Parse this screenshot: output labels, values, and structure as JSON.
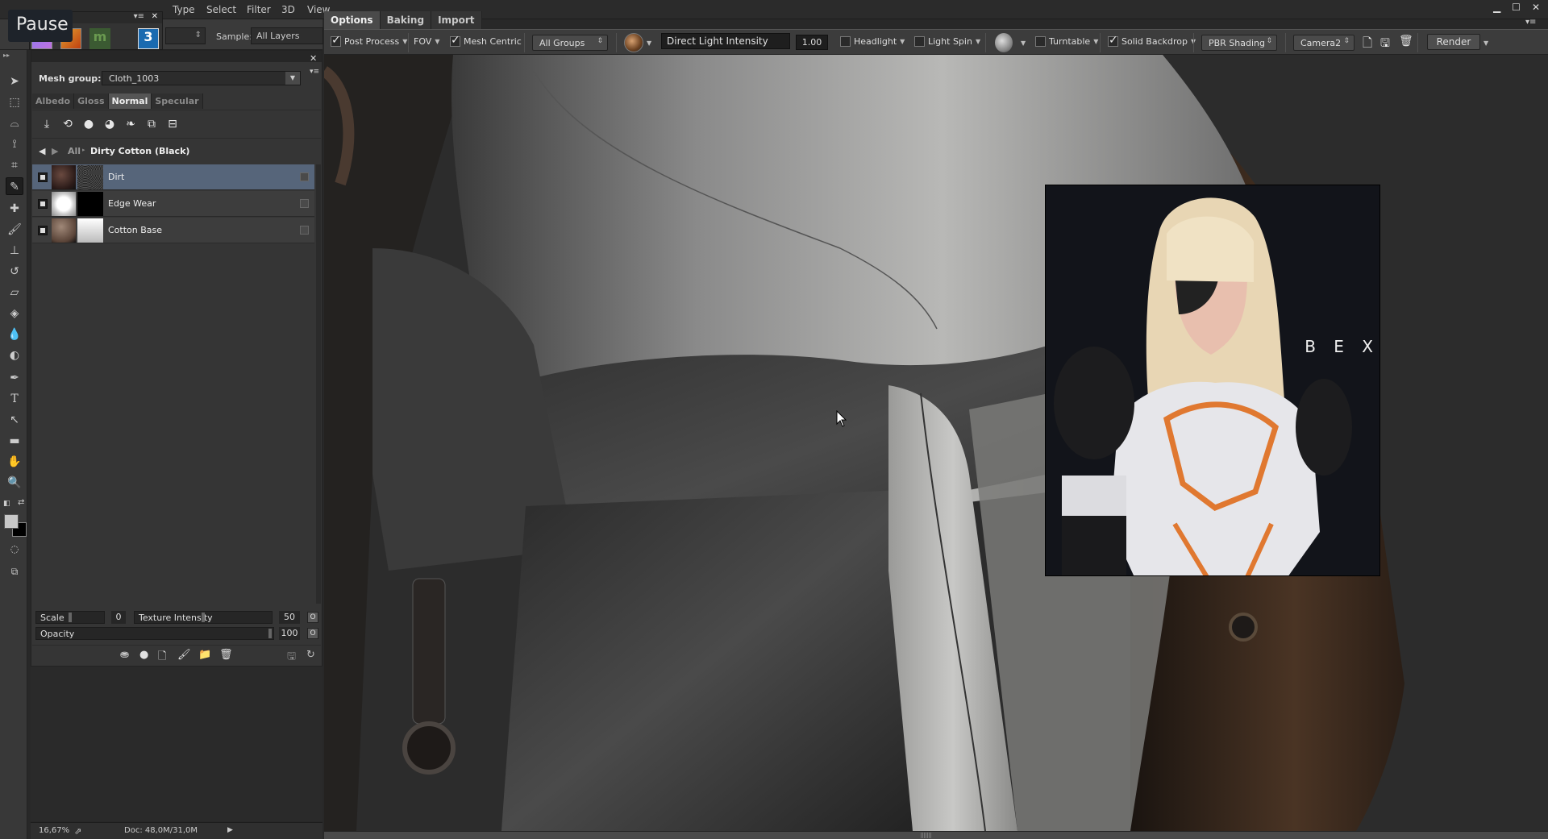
{
  "menubar": {
    "items": [
      "Type",
      "Select",
      "Filter",
      "3D",
      "View"
    ],
    "window_controls": [
      "minimize-icon",
      "maximize-icon",
      "close-icon"
    ]
  },
  "overlay": {
    "pause_tooltip": "Pause"
  },
  "options_left": {
    "sample_label": "Sample:",
    "sample_value": "All Layers"
  },
  "mini_panel": {
    "apps": [
      "app-purple",
      "app-orange",
      "app-m",
      "app-3"
    ]
  },
  "painter": {
    "tabs": [
      {
        "label": "Options",
        "active": true
      },
      {
        "label": "Baking",
        "active": false
      },
      {
        "label": "Import",
        "active": false
      }
    ],
    "toolbar": {
      "post_process": {
        "label": "Post Process",
        "checked": true
      },
      "fov_label": "FOV",
      "mesh_centric": {
        "label": "Mesh Centric",
        "checked": true
      },
      "groups_select": "All Groups",
      "light_field": "Direct Light Intensity",
      "light_value": "1.00",
      "headlight": {
        "label": "Headlight",
        "checked": false
      },
      "light_spin": {
        "label": "Light Spin",
        "checked": false
      },
      "turntable": {
        "label": "Turntable",
        "checked": false
      },
      "solid_backdrop": {
        "label": "Solid Backdrop",
        "checked": true
      },
      "shading_select": "PBR Shading",
      "camera_select": "Camera2",
      "render_label": "Render"
    }
  },
  "tools": {
    "items": [
      "move-tool",
      "marquee-tool",
      "lasso-tool",
      "quick-select-tool",
      "crop-tool",
      "eyedropper-tool",
      "healing-tool",
      "brush-tool",
      "stamp-tool",
      "history-brush-tool",
      "eraser-tool",
      "paint-bucket-tool",
      "blur-tool",
      "dodge-tool",
      "pen-tool",
      "type-tool",
      "path-select-tool",
      "shape-tool",
      "hand-tool",
      "zoom-tool"
    ],
    "active": "eyedropper-tool",
    "foreground_color": "#c8c8c8",
    "background_color": "#000000"
  },
  "panel": {
    "mesh_group_label": "Mesh group:",
    "mesh_group_value": "Cloth_1003",
    "channel_tabs": [
      {
        "label": "Albedo",
        "active": false
      },
      {
        "label": "Gloss",
        "active": false
      },
      {
        "label": "Normal",
        "active": true
      },
      {
        "label": "Specular",
        "active": false
      }
    ],
    "breadcrumb": {
      "root": "All",
      "current": "Dirty Cotton (Black)"
    },
    "layers": [
      {
        "name": "Dirt",
        "selected": true
      },
      {
        "name": "Edge Wear",
        "selected": false
      },
      {
        "name": "Cotton Base",
        "selected": false
      }
    ],
    "scale": {
      "label": "Scale",
      "value": "0"
    },
    "texture_intensity": {
      "label": "Texture Intensity",
      "value": "50"
    },
    "opacity": {
      "label": "Opacity",
      "value": "100"
    }
  },
  "status": {
    "zoom": "16,67%",
    "doc": "Doc: 48,0M/31,0M"
  },
  "viewport": {
    "ref_logo": "B E X"
  }
}
